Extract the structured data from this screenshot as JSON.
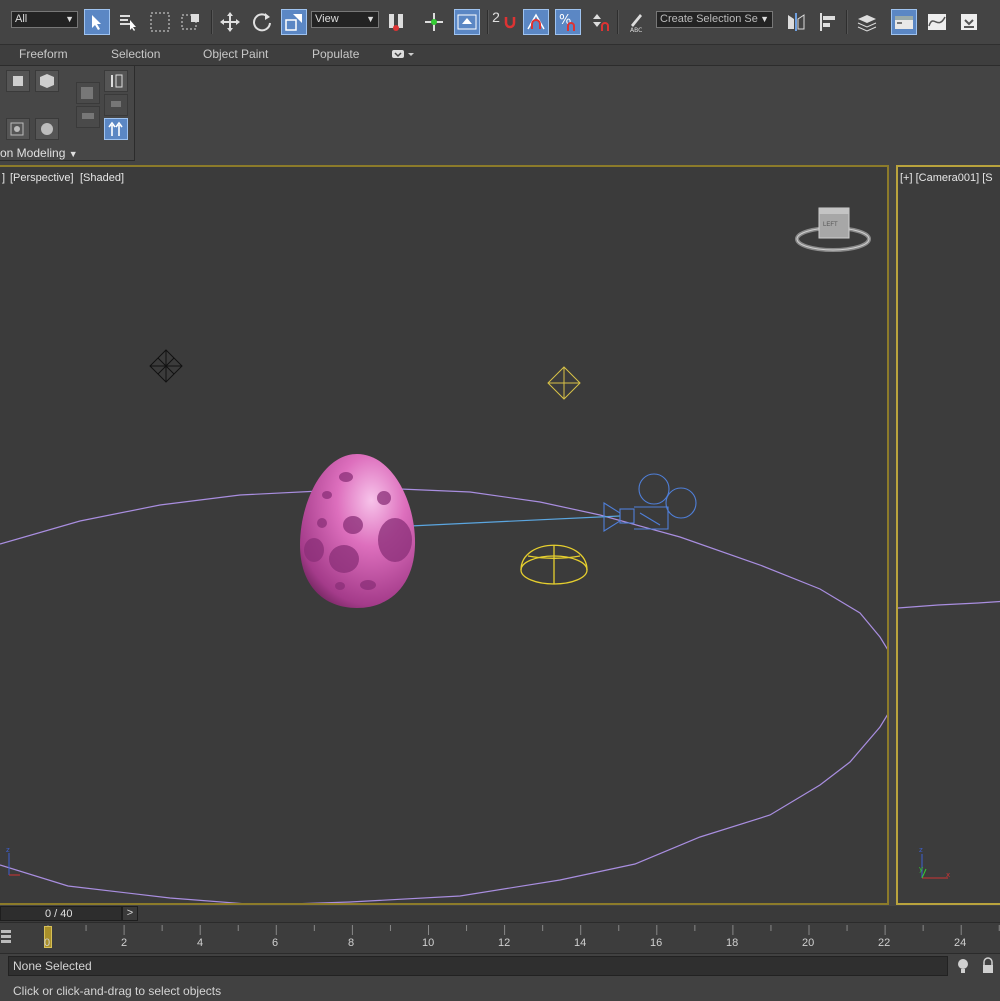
{
  "toolbar": {
    "selection_filter": "All",
    "ref_coord": "View",
    "snap_number": "2",
    "named_selection_placeholder": "Create Selection Se"
  },
  "ribbon": {
    "tabs": [
      "Freeform",
      "Selection",
      "Object Paint",
      "Populate"
    ],
    "panel_title": "on Modeling"
  },
  "viewport_persp": {
    "label_a": "]",
    "label_b": "[Perspective]",
    "label_c": "[Shaded]",
    "viewcube_face": "LEFT"
  },
  "viewport_cam": {
    "label": "[+] [Camera001] [S"
  },
  "time_slider": {
    "frame": "0 / 40",
    "next_label": ">"
  },
  "timeline": {
    "ticks": [
      "0",
      "2",
      "4",
      "6",
      "8",
      "10",
      "12",
      "14",
      "16",
      "18",
      "20",
      "22",
      "24"
    ]
  },
  "status": {
    "selection": "None Selected",
    "prompt": "Click or click-and-drag to select objects"
  },
  "colors": {
    "accent": "#5b87c4",
    "viewport_border": "#8c7b2a",
    "egg": "#d45cb0",
    "path": "#a98ee0",
    "camera": "#4f7fd8",
    "omni_light": "#d8c247"
  }
}
